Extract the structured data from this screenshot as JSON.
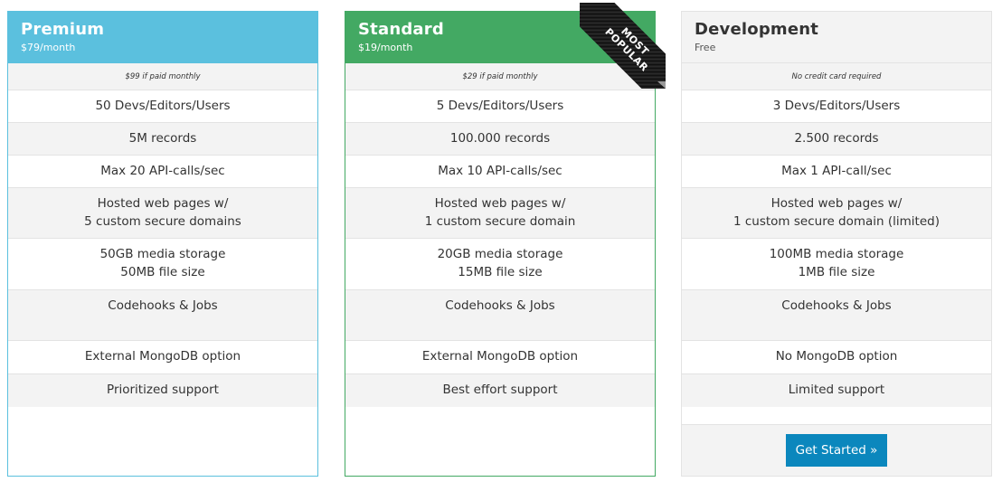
{
  "plans": [
    {
      "name": "Premium",
      "price": "$79/month",
      "note": "$99 if paid monthly",
      "accent_color": "#5bc0de",
      "features": [
        "50 Devs/Editors/Users",
        "5M records",
        "Max 20 API-calls/sec",
        "Hosted web pages w/\n5 custom secure domains",
        "50GB media storage\n50MB file size",
        "Codehooks & Jobs",
        "External MongoDB option",
        "Prioritized support"
      ]
    },
    {
      "name": "Standard",
      "price": "$19/month",
      "note": "$29 if paid monthly",
      "accent_color": "#43a963",
      "badge": [
        "MOST",
        "POPULAR"
      ],
      "features": [
        "5 Devs/Editors/Users",
        "100.000 records",
        "Max 10 API-calls/sec",
        "Hosted web pages w/\n1 custom secure domain",
        "20GB media storage\n15MB file size",
        "Codehooks & Jobs",
        "External MongoDB option",
        "Best effort support"
      ]
    },
    {
      "name": "Development",
      "price": "Free",
      "note": "No credit card required",
      "accent_color": "#f3f3f3",
      "features": [
        "3 Devs/Editors/Users",
        "2.500 records",
        "Max 1 API-call/sec",
        "Hosted web pages w/\n1 custom secure domain (limited)",
        "100MB media storage\n1MB file size",
        "Codehooks & Jobs",
        "No MongoDB option",
        "Limited support"
      ],
      "cta_label": "Get Started »",
      "cta_color": "#0b87bd"
    }
  ]
}
